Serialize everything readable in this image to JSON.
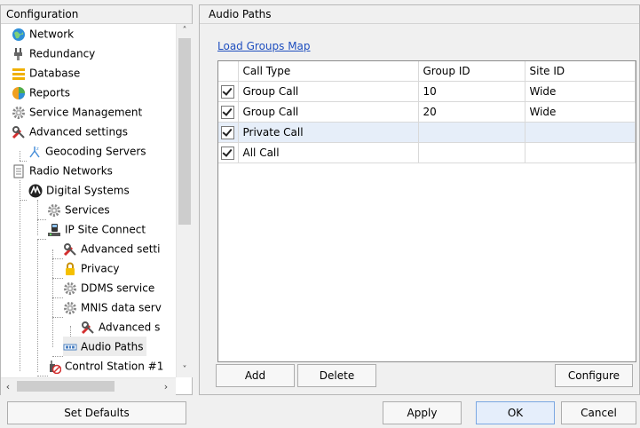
{
  "left_panel": {
    "title": "Configuration",
    "tree": [
      {
        "label": "Network",
        "icon": "globe-icon"
      },
      {
        "label": "Redundancy",
        "icon": "plug-icon"
      },
      {
        "label": "Database",
        "icon": "database-icon"
      },
      {
        "label": "Reports",
        "icon": "reports-icon"
      },
      {
        "label": "Service Management",
        "icon": "gear-icon"
      },
      {
        "label": "Advanced settings",
        "icon": "tools-icon"
      },
      {
        "label": "Geocoding Servers",
        "icon": "geocoding-icon"
      },
      {
        "label": "Radio Networks",
        "icon": "document-icon"
      },
      {
        "label": "Digital Systems",
        "icon": "motorola-icon"
      },
      {
        "label": "Services",
        "icon": "gear-icon"
      },
      {
        "label": "IP Site Connect",
        "icon": "site-connect-icon"
      },
      {
        "label": "Advanced setti",
        "icon": "tools-icon"
      },
      {
        "label": "Privacy",
        "icon": "lock-icon"
      },
      {
        "label": "DDMS service",
        "icon": "gear-icon"
      },
      {
        "label": "MNIS data serv",
        "icon": "gear-icon"
      },
      {
        "label": "Advanced s",
        "icon": "tools-icon"
      },
      {
        "label": "Audio Paths",
        "icon": "audio-paths-icon"
      },
      {
        "label": "Control Station #1",
        "icon": "control-station-icon"
      }
    ]
  },
  "right_panel": {
    "title": "Audio Paths",
    "link_label": "Load Groups Map",
    "columns": [
      "Call Type",
      "Group ID",
      "Site ID"
    ],
    "rows": [
      {
        "checked": true,
        "call_type": "Group Call",
        "group_id": "10",
        "site_id": "Wide"
      },
      {
        "checked": true,
        "call_type": "Group Call",
        "group_id": "20",
        "site_id": "Wide"
      },
      {
        "checked": true,
        "call_type": "Private Call",
        "group_id": "",
        "site_id": ""
      },
      {
        "checked": true,
        "call_type": "All Call",
        "group_id": "",
        "site_id": ""
      }
    ],
    "selected_row_index": 2,
    "buttons": {
      "add": "Add",
      "delete": "Delete",
      "configure": "Configure"
    }
  },
  "footer": {
    "set_defaults": "Set Defaults",
    "apply": "Apply",
    "ok": "OK",
    "cancel": "Cancel"
  },
  "colors": {
    "link": "#1f4fbf",
    "selection": "#e6eef9",
    "ok_button": "#e5eefb"
  }
}
